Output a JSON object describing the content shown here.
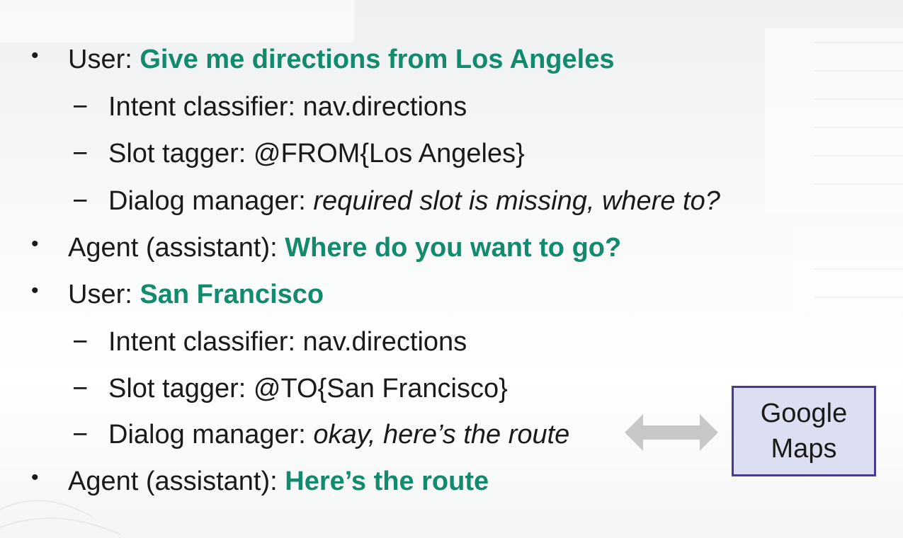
{
  "slide": {
    "items": [
      {
        "kind": "bullet",
        "prefix": "User: ",
        "emph": "Give me directions from Los Angeles"
      },
      {
        "kind": "sub",
        "prefix": "Intent classifier: nav.directions",
        "emph": ""
      },
      {
        "kind": "sub",
        "prefix": "Slot tagger: @FROM{Los Angeles}",
        "emph": ""
      },
      {
        "kind": "sub",
        "prefix": "Dialog manager: ",
        "emph": "required slot is missing, where to?"
      },
      {
        "kind": "bullet",
        "prefix": "Agent (assistant): ",
        "emph": "Where do you want to go?"
      },
      {
        "kind": "bullet",
        "prefix": "User: ",
        "emph": "San Francisco"
      },
      {
        "kind": "sub",
        "prefix": "Intent classifier: nav.directions",
        "emph": ""
      },
      {
        "kind": "sub",
        "prefix": "Slot tagger: @TO{San Francisco}",
        "emph": ""
      },
      {
        "kind": "sub",
        "prefix": "Dialog manager: ",
        "emph": "okay, here’s the route"
      },
      {
        "kind": "bullet",
        "prefix": "Agent (assistant): ",
        "emph": "Here’s the route"
      }
    ],
    "bullet_symbol": "•",
    "dash_symbol": "−"
  },
  "maps_box": {
    "line1": "Google",
    "line2": "Maps"
  },
  "colors": {
    "highlight": "#118a6e",
    "box_fill": "#dcdff2",
    "box_border": "#4a3a8c",
    "arrow": "#c8c8c8"
  }
}
